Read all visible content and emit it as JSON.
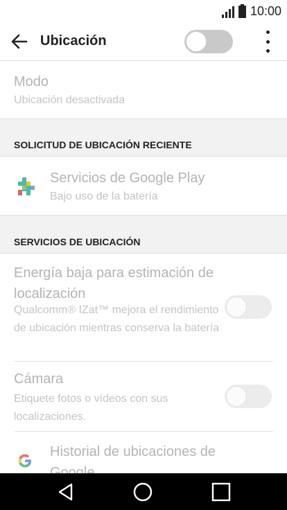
{
  "status_bar": {
    "time": "10:00"
  },
  "app_bar": {
    "title": "Ubicación",
    "location_toggle_on": false
  },
  "mode": {
    "title": "Modo",
    "subtitle": "Ubicación desactivada"
  },
  "section_recent": {
    "label": "SOLICITUD DE UBICACIÓN RECIENTE"
  },
  "recent_items": [
    {
      "title": "Servicios de Google Play",
      "subtitle": "Bajo uso de la batería",
      "icon": "google-play-services-icon"
    }
  ],
  "section_services": {
    "label": "SERVICIOS DE UBICACIÓN"
  },
  "services": [
    {
      "title": "Energía baja para estimación de localización",
      "subtitle": "Qualcomm® IZat™ mejora el rendimiento de ubicación mientras conserva la batería",
      "toggle_on": false
    },
    {
      "title": "Cámara",
      "subtitle": "Etiquete fotos o vídeos con sus localizaciones.",
      "toggle_on": false
    },
    {
      "title": "Historial de ubicaciones de Google",
      "icon": "google-icon"
    }
  ],
  "nav_bar": {
    "buttons": [
      "back-icon",
      "home-icon",
      "recents-icon"
    ]
  },
  "colors": {
    "disabled_text": "#b4b4b4",
    "section_bg": "#f2f2f2",
    "nav_bg": "#000000"
  }
}
